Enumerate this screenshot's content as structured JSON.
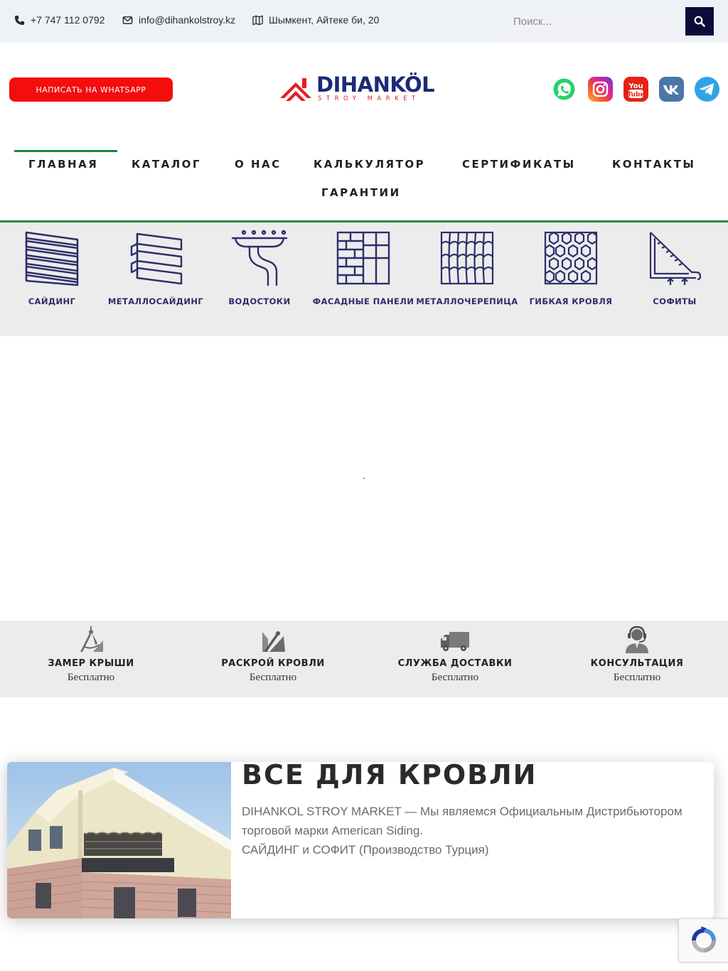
{
  "topbar": {
    "phone": "+7 747 112 0792",
    "email": "info@dihankolstroy.kz",
    "address": "Шымкент, Айтеке би, 20",
    "search_placeholder": "Поиск..."
  },
  "header": {
    "whatsapp_button": "НАПИСАТЬ НА WHATSAPP",
    "logo_name": "DIHANKÖL",
    "logo_sub": "STROY MARKET",
    "socials": [
      "whatsapp-icon",
      "instagram-icon",
      "youtube-icon",
      "vk-icon",
      "telegram-icon"
    ]
  },
  "nav": {
    "items": [
      "ГЛАВНАЯ",
      "КАТАЛОГ",
      "О НАС",
      "КАЛЬКУЛЯТОР",
      "СЕРТИФИКАТЫ",
      "КОНТАКТЫ",
      "ГАРАНТИИ"
    ],
    "active": "ГЛАВНАЯ"
  },
  "categories": [
    {
      "label": "САЙДИНГ",
      "icon": "siding-icon"
    },
    {
      "label": "МЕТАЛЛОСАЙДИНГ",
      "icon": "metal-siding-icon"
    },
    {
      "label": "ВОДОСТОКИ",
      "icon": "gutter-icon"
    },
    {
      "label": "ФАСАДНЫЕ ПАНЕЛИ",
      "icon": "facade-panel-icon"
    },
    {
      "label": "МЕТАЛЛОЧЕРЕПИЦА",
      "icon": "metal-tile-icon"
    },
    {
      "label": "ГИБКАЯ КРОВЛЯ",
      "icon": "flexible-roof-icon"
    },
    {
      "label": "СОФИТЫ",
      "icon": "soffit-icon"
    }
  ],
  "services": [
    {
      "title": "ЗАМЕР КРЫШИ",
      "subtitle": "Бесплатно",
      "icon": "compass-icon"
    },
    {
      "title": "РАСКРОЙ КРОВЛИ",
      "subtitle": "Бесплатно",
      "icon": "cutting-icon"
    },
    {
      "title": "СЛУЖБА ДОСТАВКИ",
      "subtitle": "Бесплатно",
      "icon": "truck-icon"
    },
    {
      "title": "КОНСУЛЬТАЦИЯ",
      "subtitle": "Бесплатно",
      "icon": "operator-icon"
    }
  ],
  "about": {
    "title": "ВСЕ ДЛЯ КРОВЛИ",
    "line1": "DIHANKOL STROY MARKET — Мы являемся Официальным Дистрибьютором торговой марки American Siding.",
    "line2": "САЙДИНГ и СОФИТ (Производство Турция)"
  },
  "colors": {
    "accent_green": "#1a8a3a",
    "brand_navy": "#1b2a78",
    "whatsapp_red": "#f30d0d",
    "search_button": "#0c0c3b",
    "category_ink": "#2d2d6b"
  }
}
